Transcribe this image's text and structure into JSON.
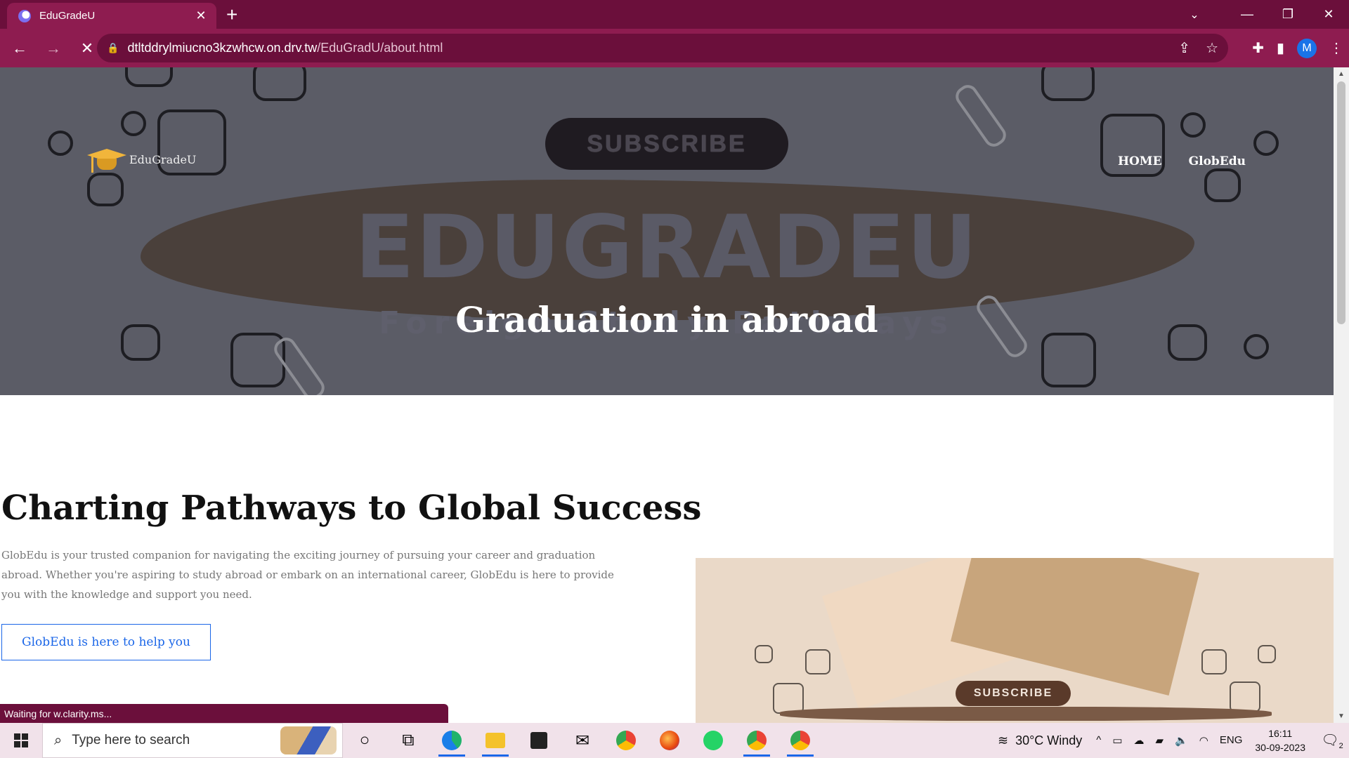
{
  "browser": {
    "tab_title": "EduGradeU",
    "tab_close": "✕",
    "new_tab": "+",
    "url_host": "dtltddrylmiucno3kzwhcw.on.drv.tw",
    "url_path": "/EduGradU/about.html",
    "profile_initial": "M",
    "status_text": "Waiting for w.clarity.ms..."
  },
  "hero": {
    "subscribe_label": "SUBSCRIBE",
    "big_word": "EDUGRADEU",
    "ghost_subtitle": "Foreign Study Pathways",
    "tagline": "Graduation in abroad",
    "logo_text": "EduGradeU",
    "nav": [
      "HOME",
      "GlobEdu"
    ]
  },
  "about": {
    "heading": "Charting Pathways to Global Success",
    "text": "GlobEdu is your trusted companion for navigating the exciting journey of pursuing your career and graduation abroad. Whether you're aspiring to study abroad or embark on an international career, GlobEdu is here to provide you with the knowledge and support you need.",
    "button_label": "GlobEdu is here to help you",
    "image_subscribe_label": "SUBSCRIBE"
  },
  "taskbar": {
    "search_placeholder": "Type here to search",
    "weather": "30°C  Windy",
    "language": "ENG",
    "time": "16:11",
    "date": "30-09-2023",
    "notifications": "2"
  },
  "colors": {
    "chrome_dark": "#6b0f3b",
    "chrome_light": "#8e1c50",
    "link_blue": "#1a66e8"
  }
}
